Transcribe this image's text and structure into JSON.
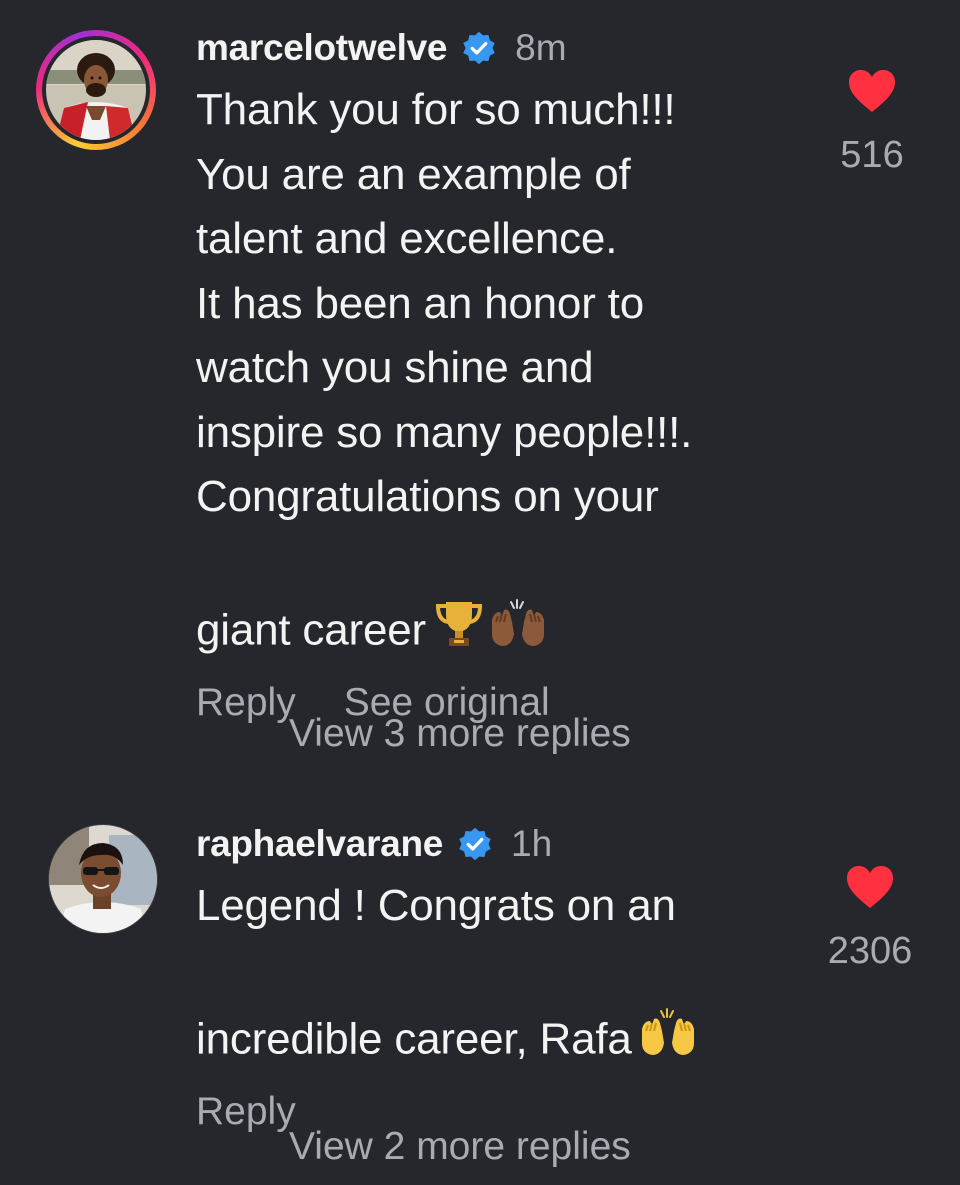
{
  "comments": [
    {
      "username": "marcelotwelve",
      "verified": true,
      "time": "8m",
      "text": "Thank you for so much!!!\nYou are an example of\ntalent and excellence.\nIt has been an honor to\nwatch you shine and\ninspire so many people!!!.\nCongratulations on your\ngiant career",
      "emojis": [
        "trophy-icon",
        "raising-hands-icon"
      ],
      "likes": "516",
      "liked": true,
      "actions": [
        "Reply",
        "See original"
      ],
      "view_more": "View 3 more replies"
    },
    {
      "username": "raphaelvarane",
      "verified": true,
      "time": "1h",
      "text": "Legend ! Congrats on an\nincredible career, Rafa",
      "emojis": [
        "raising-hands-icon"
      ],
      "likes": "2306",
      "liked": true,
      "actions": [
        "Reply"
      ],
      "view_more": "View 2 more replies"
    }
  ],
  "colors": {
    "background": "#25272c",
    "text": "#f3f3f3",
    "secondary": "#a8abb2",
    "heart": "#ff3040",
    "verified": "#3897f0"
  }
}
